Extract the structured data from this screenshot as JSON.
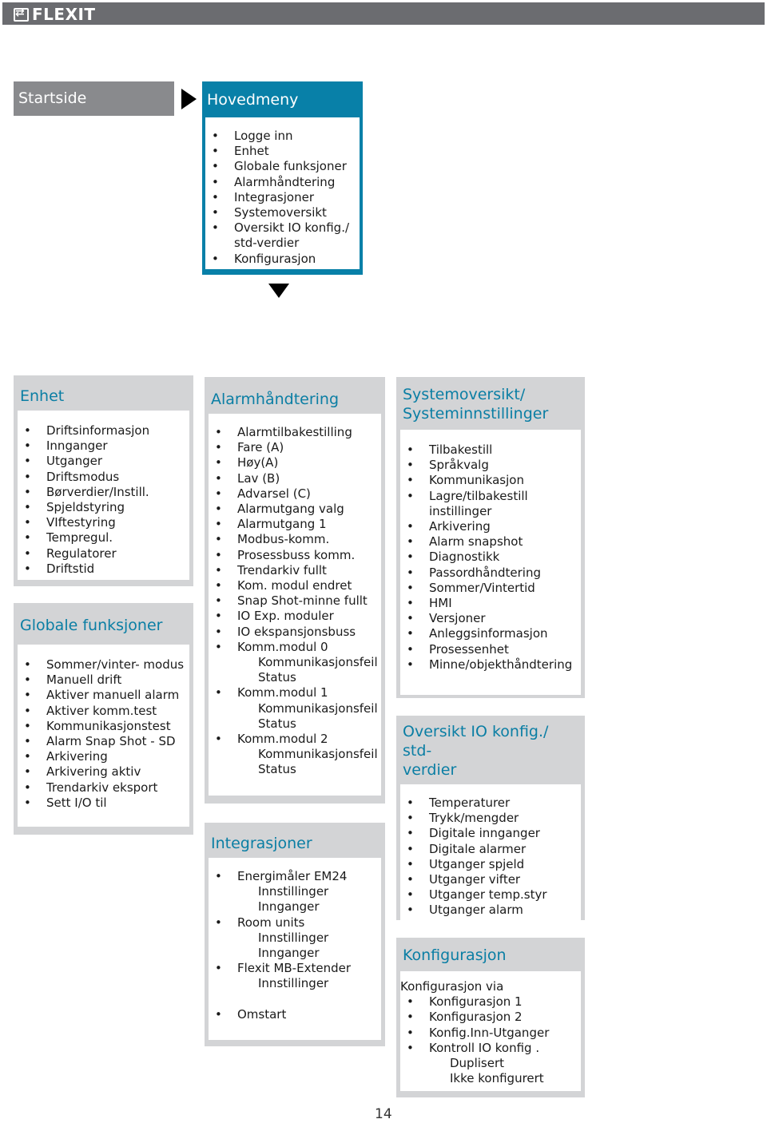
{
  "header": {
    "logo_text": "FLEXIT",
    "logo_icon": "flexit-arrows-icon",
    "bar_color": "#6b6c70"
  },
  "colors": {
    "accent_blue": "#0880a8",
    "box_grey": "#d3d4d6",
    "startside_grey": "#898a8d",
    "title_blue": "#0a7ea4"
  },
  "startside": {
    "label": "Startside"
  },
  "hovedmeny": {
    "title": "Hovedmeny",
    "items": [
      {
        "label": "Logge inn"
      },
      {
        "label": "Enhet"
      },
      {
        "label": "Globale funksjoner"
      },
      {
        "label": "Alarmhåndtering"
      },
      {
        "label": "Integrasjoner"
      },
      {
        "label": "Systemoversikt"
      },
      {
        "label": "Oversikt IO konfig./",
        "sub": [
          "std-verdier"
        ]
      },
      {
        "label": "Konfigurasjon"
      }
    ]
  },
  "enhet": {
    "title": "Enhet",
    "items": [
      {
        "label": "Driftsinformasjon"
      },
      {
        "label": "Innganger"
      },
      {
        "label": "Utganger"
      },
      {
        "label": "Driftsmodus"
      },
      {
        "label": "Børverdier/Instill."
      },
      {
        "label": "Spjeldstyring"
      },
      {
        "label": "VIftestyring"
      },
      {
        "label": "Tempregul."
      },
      {
        "label": "Regulatorer"
      },
      {
        "label": "Driftstid"
      }
    ]
  },
  "globale": {
    "title": "Globale funksjoner",
    "items": [
      {
        "label": "Sommer/vinter- modus"
      },
      {
        "label": "Manuell drift"
      },
      {
        "label": "Aktiver manuell alarm"
      },
      {
        "label": "Aktiver komm.test"
      },
      {
        "label": "Kommunikasjonstest"
      },
      {
        "label": "Alarm Snap Shot - SD"
      },
      {
        "label": "Arkivering"
      },
      {
        "label": "Arkivering aktiv"
      },
      {
        "label": "Trendarkiv eksport"
      },
      {
        "label": "Sett I/O til"
      }
    ]
  },
  "alarm": {
    "title": "Alarmhåndtering",
    "items": [
      {
        "label": "Alarmtilbakestilling"
      },
      {
        "label": "Fare (A)"
      },
      {
        "label": "Høy(A)"
      },
      {
        "label": "Lav (B)"
      },
      {
        "label": "Advarsel (C)"
      },
      {
        "label": "Alarmutgang valg"
      },
      {
        "label": "Alarmutgang 1"
      },
      {
        "label": "Modbus-komm."
      },
      {
        "label": "Prosessbuss komm."
      },
      {
        "label": "Trendarkiv fullt"
      },
      {
        "label": "Kom. modul endret"
      },
      {
        "label": "Snap Shot-minne fullt"
      },
      {
        "label": "IO Exp. moduler"
      },
      {
        "label": "IO ekspansjonsbuss"
      },
      {
        "label": "Komm.modul 0",
        "sub": [
          "Kommunikasjonsfeil",
          "Status"
        ]
      },
      {
        "label": "Komm.modul 1",
        "sub": [
          "Kommunikasjonsfeil",
          "Status"
        ]
      },
      {
        "label": "Komm.modul 2",
        "sub": [
          "Kommunikasjonsfeil",
          "Status"
        ]
      }
    ]
  },
  "integrasjoner": {
    "title": "Integrasjoner",
    "items": [
      {
        "label": "Energimåler EM24",
        "sub": [
          "Innstillinger",
          "Innganger"
        ]
      },
      {
        "label": "Room units",
        "sub": [
          "Innstillinger",
          "Innganger"
        ]
      },
      {
        "label": "Flexit MB-Extender",
        "sub": [
          "Innstillinger"
        ]
      },
      {
        "label": "Omstart"
      }
    ]
  },
  "system": {
    "title_line1": "Systemoversikt/",
    "title_line2": "Systeminnstillinger",
    "items": [
      {
        "label": "Tilbakestill"
      },
      {
        "label": "Språkvalg"
      },
      {
        "label": "Kommunikasjon"
      },
      {
        "label": "Lagre/tilbakestill",
        "sub": [
          "instillinger"
        ]
      },
      {
        "label": "Arkivering"
      },
      {
        "label": "Alarm snapshot"
      },
      {
        "label": "Diagnostikk"
      },
      {
        "label": "Passordhåndtering"
      },
      {
        "label": "Sommer/Vintertid"
      },
      {
        "label": "HMI"
      },
      {
        "label": "Versjoner"
      },
      {
        "label": "Anleggsinformasjon"
      },
      {
        "label": "Prosessenhet"
      },
      {
        "label": "Minne/objekthåndtering"
      }
    ]
  },
  "oversikt": {
    "title_line1": "Oversikt IO konfig./ std-",
    "title_line2": "verdier",
    "items": [
      {
        "label": "Temperaturer"
      },
      {
        "label": "Trykk/mengder"
      },
      {
        "label": "Digitale innganger"
      },
      {
        "label": "Digitale alarmer"
      },
      {
        "label": "Utganger spjeld"
      },
      {
        "label": "Utganger vifter"
      },
      {
        "label": "Utganger temp.styr"
      },
      {
        "label": "Utganger alarm"
      }
    ]
  },
  "konfig": {
    "title": "Konfigurasjon",
    "intro": "Konfigurasjon via",
    "items": [
      {
        "label": "Konfigurasjon 1"
      },
      {
        "label": "Konfigurasjon 2"
      },
      {
        "label": "Konfig.Inn-Utganger"
      },
      {
        "label": "Kontroll IO konfig .",
        "sub": [
          "Duplisert",
          "Ikke konfigurert"
        ]
      }
    ]
  },
  "bullet_glyph": "•",
  "page_number": "14"
}
